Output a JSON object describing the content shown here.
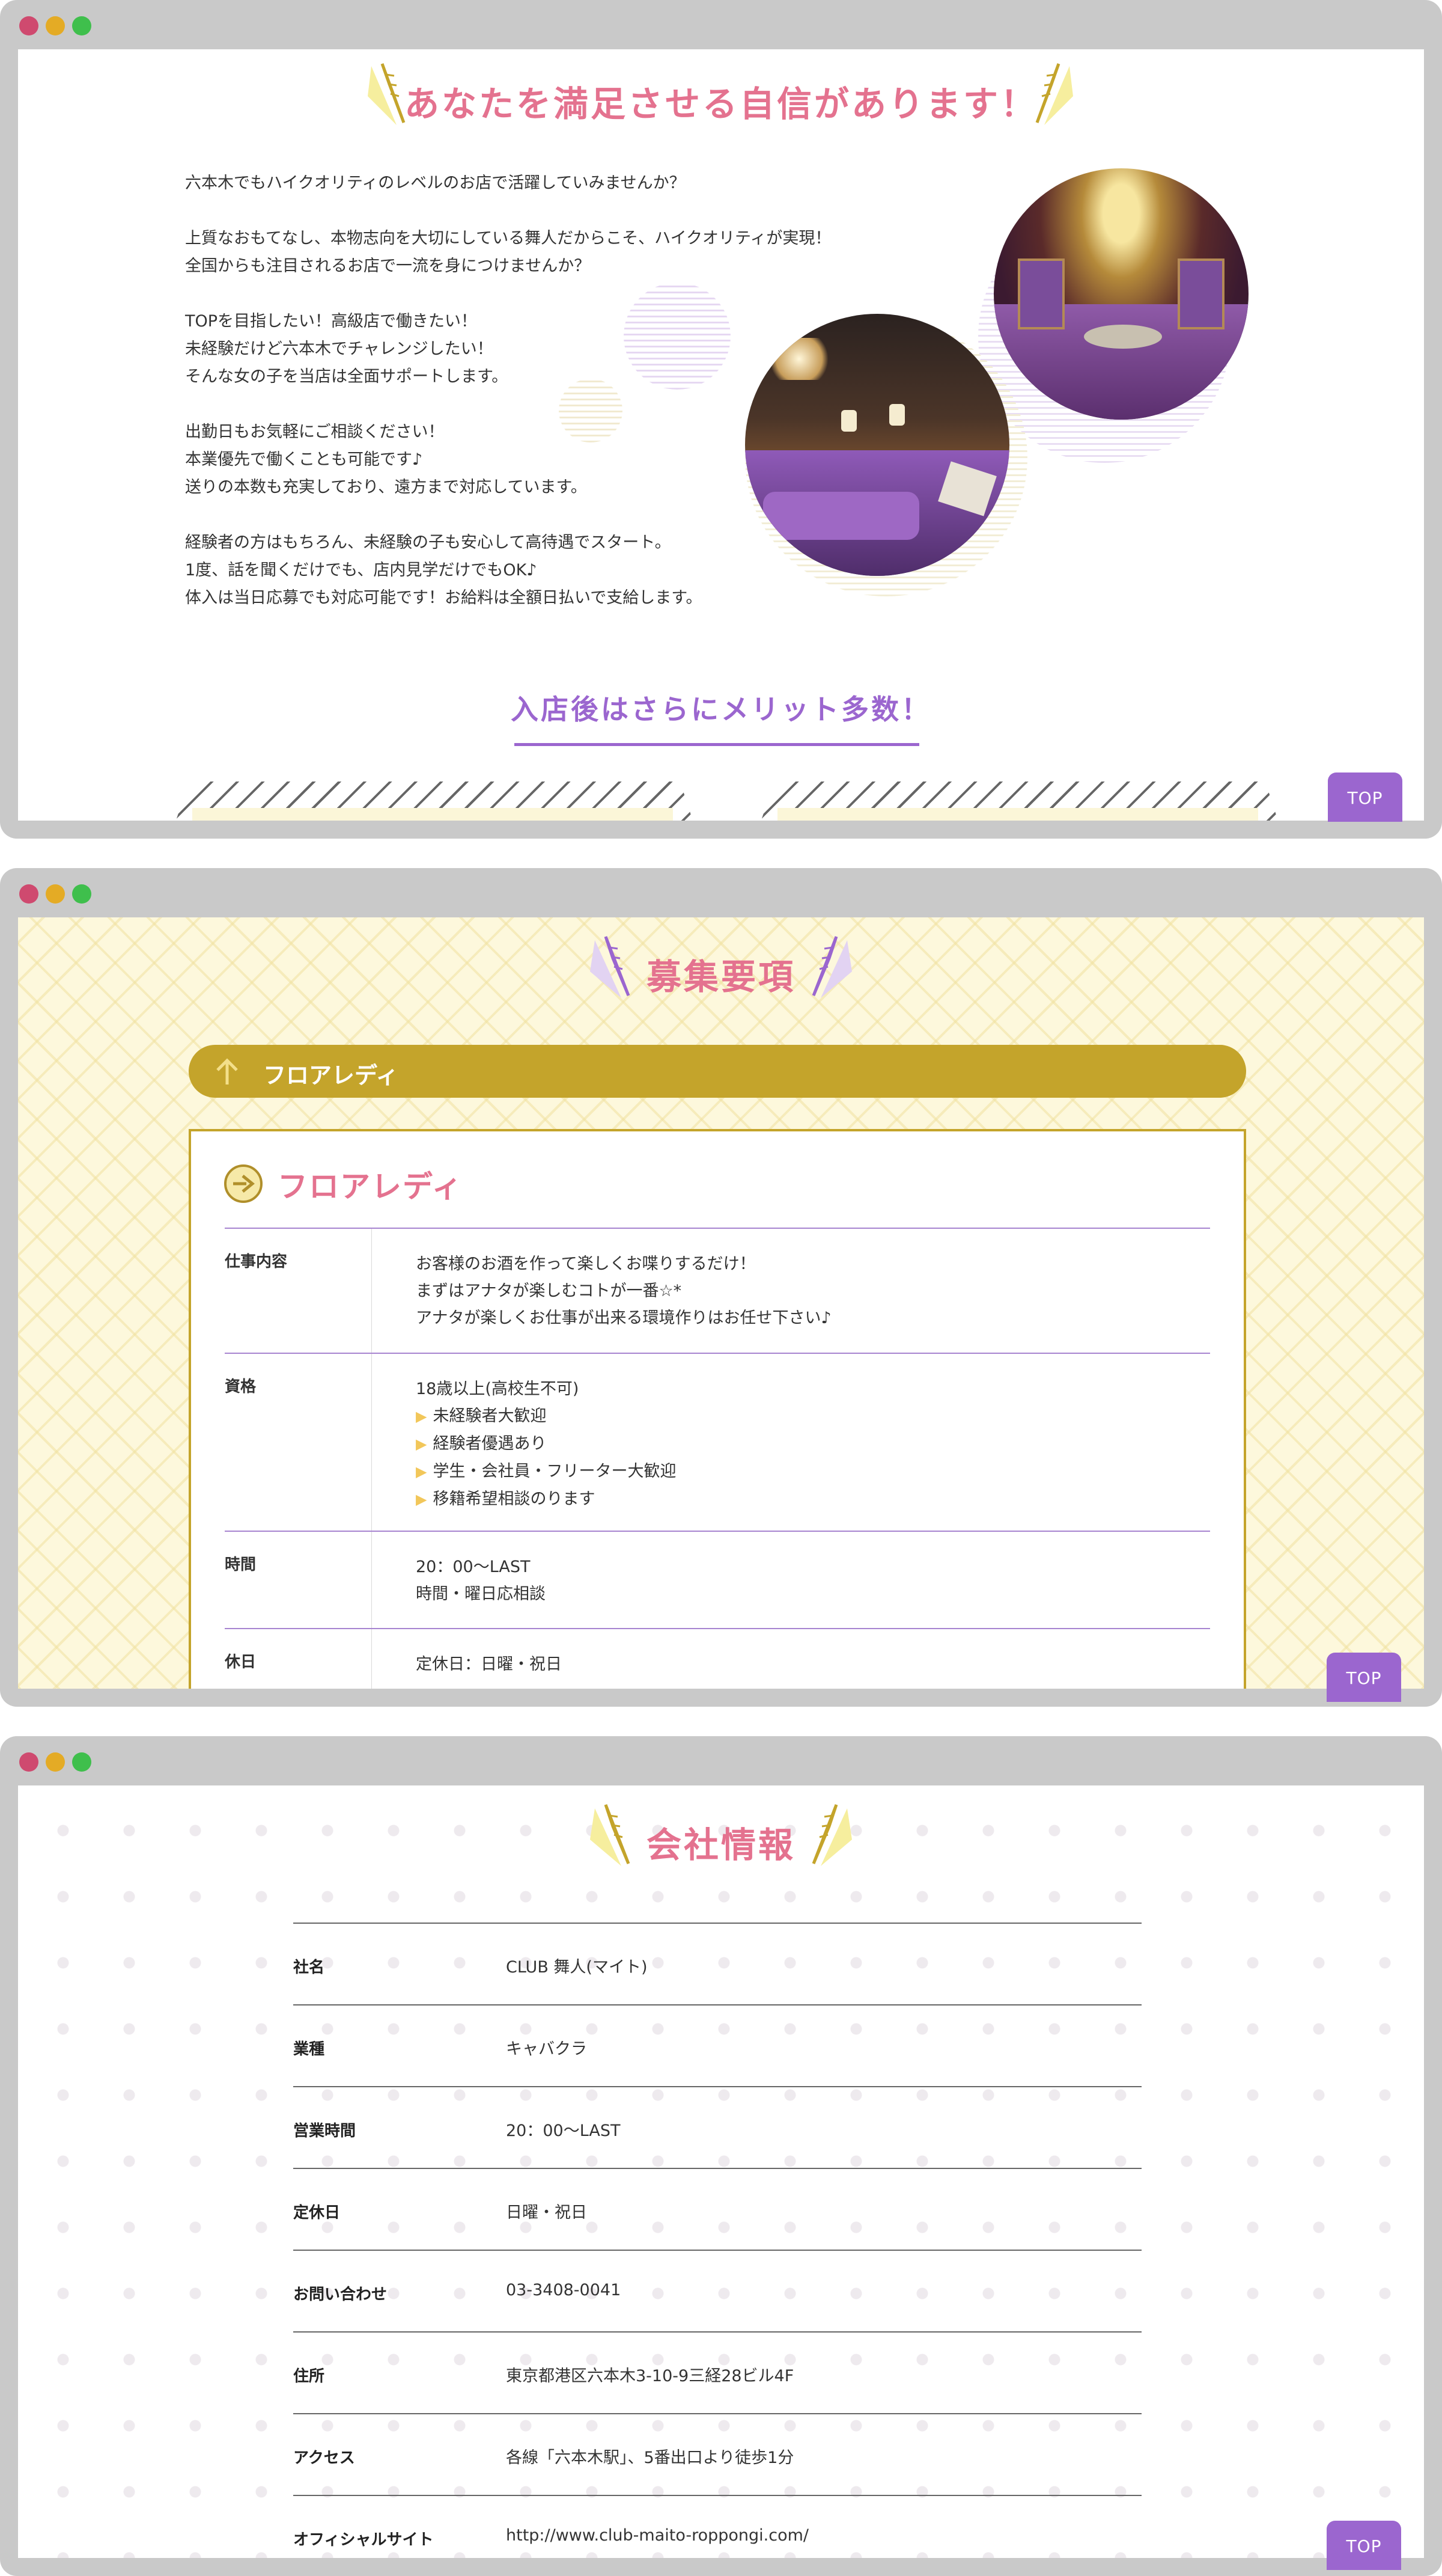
{
  "colors": {
    "accent_pink": "#e4728f",
    "accent_purple": "#9b66cf",
    "gold": "#c4a42b",
    "window_frame": "#c9c9c9"
  },
  "window_controls": [
    "close",
    "minimize",
    "maximize"
  ],
  "top_button_label": "TOP",
  "section1": {
    "heading": "あなたを満足させる自信があります！",
    "paragraphs": [
      [
        "六本木でもハイクオリティのレベルのお店で活躍していみませんか？"
      ],
      [
        "上質なおもてなし、本物志向を大切にしている舞人だからこそ、ハイクオリティが実現！",
        "全国からも注目されるお店で一流を身につけませんか？"
      ],
      [
        "TOPを目指したい！高級店で働きたい！",
        "未経験だけど六本木でチャレンジしたい！",
        "そんな女の子を当店は全面サポートします。"
      ],
      [
        "出勤日もお気軽にご相談ください！",
        "本業優先で働くことも可能です♪",
        "送りの本数も充実しており、遠方まで対応しています。"
      ],
      [
        "経験者の方はもちろん、未経験の子も安心して高待遇でスタート。",
        "1度、話を聞くだけでも、店内見学だけでもOK♪",
        "体入は当日応募でも対応可能です！お給料は全額日払いで支給します。"
      ]
    ],
    "subheading": "入店後はさらにメリット多数！"
  },
  "section2": {
    "heading": "募集要項",
    "bar_label": "フロアレディ",
    "card_title": "フロアレディ",
    "rows": [
      {
        "label": "仕事内容",
        "lines": [
          "お客様のお酒を作って楽しくお喋りするだけ！",
          "まずはアナタが楽しむコトが一番☆*",
          "アナタが楽しくお仕事が出来る環境作りはお任せ下さい♪"
        ]
      },
      {
        "label": "資格",
        "lines": [
          "18歳以上(高校生不可)"
        ],
        "bullets": [
          "未経験者大歓迎",
          "経験者優遇あり",
          "学生・会社員・フリーター大歓迎",
          "移籍希望相談のります"
        ]
      },
      {
        "label": "時間",
        "lines": [
          "20：00〜LAST",
          "時間・曜日応相談"
        ]
      },
      {
        "label": "休日",
        "lines": [
          "定休日：日曜・祝日"
        ]
      }
    ]
  },
  "section3": {
    "heading": "会社情報",
    "rows": [
      {
        "label": "社名",
        "value": "CLUB 舞人(マイト)"
      },
      {
        "label": "業種",
        "value": "キャバクラ"
      },
      {
        "label": "営業時間",
        "value": "20：00〜LAST"
      },
      {
        "label": "定休日",
        "value": "日曜・祝日"
      },
      {
        "label": "お問い合わせ",
        "value": "03-3408-0041"
      },
      {
        "label": "住所",
        "value": "東京都港区六本木3-10-9三経28ビル4F"
      },
      {
        "label": "アクセス",
        "value": "各線「六本木駅」、5番出口より徒歩1分"
      },
      {
        "label": "オフィシャルサイト",
        "value": "http://www.club-maito-roppongi.com/"
      }
    ]
  }
}
